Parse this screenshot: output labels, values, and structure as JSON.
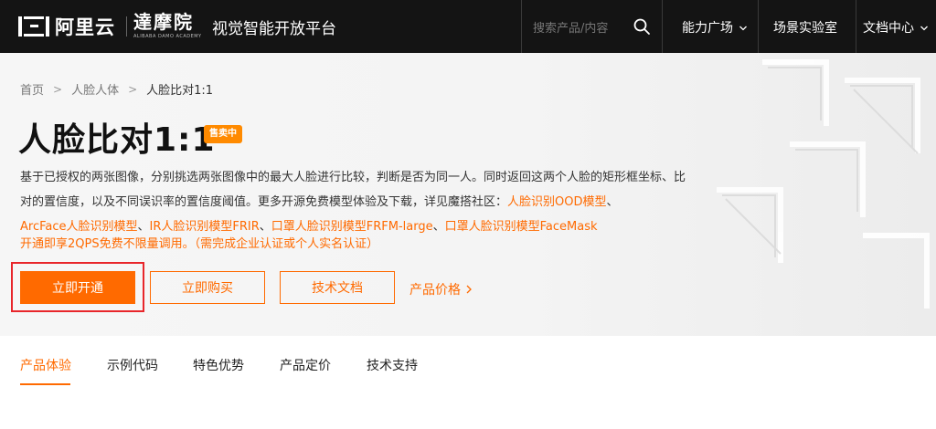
{
  "header": {
    "brand_aliyun": "阿里云",
    "brand_damo": "達摩院",
    "brand_damo_en": "ALIBABA DAMO ACADEMY",
    "platform_title": "视觉智能开放平台",
    "search": {
      "placeholder": "搜索产品/内容"
    },
    "nav": [
      {
        "label": "能力广场",
        "has_dropdown": true
      },
      {
        "label": "场景实验室",
        "has_dropdown": false
      },
      {
        "label": "文档中心",
        "has_dropdown": true
      }
    ]
  },
  "breadcrumb": {
    "items": [
      "首页",
      "人脸人体",
      "人脸比对1:1"
    ],
    "separator": ">"
  },
  "product": {
    "title": "人脸比对1:1",
    "status_badge": "售卖中",
    "description_1": "基于已授权的两张图像，分别挑选两张图像中的最大人脸进行比较，判断是否为同一人。同时返回这两个人脸的矩形框坐标、比对的置信度，以及不同误识率的置信度阈值。更多开源免费模型体验及下载，详见魔搭社区：",
    "links": [
      "人脸识别OOD模型",
      "ArcFace人脸识别模型",
      "IR人脸识别模型FRIR",
      "口罩人脸识别模型FRFM-large",
      "口罩人脸识别模型FaceMask"
    ],
    "link_separator": "、",
    "promo": "开通即享2QPS免费不限量调用。（需完成企业认证或个人实名认证）"
  },
  "actions": {
    "activate_label": "立即开通",
    "buy_label": "立即购买",
    "docs_label": "技术文档",
    "price_label": "产品价格"
  },
  "tabs": [
    {
      "label": "产品体验",
      "active": true
    },
    {
      "label": "示例代码",
      "active": false
    },
    {
      "label": "特色优势",
      "active": false
    },
    {
      "label": "产品定价",
      "active": false
    },
    {
      "label": "技术支持",
      "active": false
    }
  ],
  "colors": {
    "accent": "#ff6a00",
    "header_bg": "#141414",
    "highlight_border": "#e8262b",
    "badge": "#ff8a00"
  },
  "icons": [
    "search-icon",
    "chevron-down-icon",
    "chevron-right-icon"
  ]
}
